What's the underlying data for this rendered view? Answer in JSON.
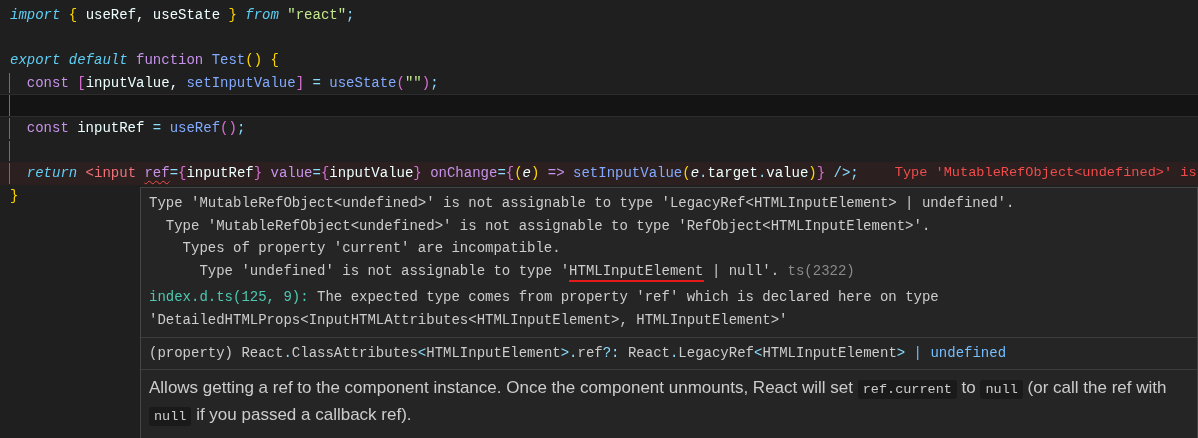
{
  "editor": {
    "lines": [
      {
        "current": false,
        "error": false,
        "indent_guide": false,
        "tokens": [
          {
            "text": "import",
            "kind": "keyword",
            "squiggle": false
          },
          {
            "text": " {",
            "kind": "brace",
            "squiggle": false
          },
          {
            "text": " useRef, useState ",
            "kind": "variable",
            "squiggle": false
          },
          {
            "text": "}",
            "kind": "brace",
            "squiggle": false
          },
          {
            "text": " from",
            "kind": "keyword",
            "squiggle": false
          },
          {
            "text": " \"react\"",
            "kind": "string",
            "squiggle": false
          },
          {
            "text": ";",
            "kind": "punct",
            "squiggle": false
          }
        ]
      },
      {
        "current": false,
        "error": false,
        "indent_guide": false
      },
      {
        "current": false,
        "error": false,
        "indent_guide": false,
        "tokens": [
          {
            "text": "export default",
            "kind": "keyword",
            "squiggle": false
          },
          {
            "text": " function",
            "kind": "storage",
            "squiggle": false
          },
          {
            "text": " Test",
            "kind": "function",
            "squiggle": false
          },
          {
            "text": "()",
            "kind": "brace",
            "squiggle": false
          },
          {
            "text": " {",
            "kind": "brace",
            "squiggle": false
          }
        ]
      },
      {
        "current": false,
        "error": false,
        "indent_guide": true,
        "tokens": [
          {
            "text": "  const",
            "kind": "storage",
            "squiggle": false
          },
          {
            "text": " [",
            "kind": "bracket",
            "squiggle": false
          },
          {
            "text": "inputValue, ",
            "kind": "variable",
            "squiggle": false
          },
          {
            "text": "setInputValue",
            "kind": "function",
            "squiggle": false
          },
          {
            "text": "]",
            "kind": "bracket",
            "squiggle": false
          },
          {
            "text": " =",
            "kind": "operator",
            "squiggle": false
          },
          {
            "text": " useState",
            "kind": "function",
            "squiggle": false
          },
          {
            "text": "(",
            "kind": "bracket",
            "squiggle": false
          },
          {
            "text": "\"\"",
            "kind": "string",
            "squiggle": false
          },
          {
            "text": ")",
            "kind": "bracket",
            "squiggle": false
          },
          {
            "text": ";",
            "kind": "punct",
            "squiggle": false
          }
        ]
      },
      {
        "current": true,
        "error": false,
        "indent_guide": true
      },
      {
        "current": false,
        "error": false,
        "indent_guide": true,
        "tokens": [
          {
            "text": "  const",
            "kind": "storage",
            "squiggle": false
          },
          {
            "text": " inputRef",
            "kind": "variable",
            "squiggle": false
          },
          {
            "text": " =",
            "kind": "operator",
            "squiggle": false
          },
          {
            "text": " useRef",
            "kind": "function",
            "squiggle": false
          },
          {
            "text": "()",
            "kind": "bracket",
            "squiggle": false
          },
          {
            "text": ";",
            "kind": "punct",
            "squiggle": false
          }
        ]
      },
      {
        "current": false,
        "error": false,
        "indent_guide": true
      },
      {
        "current": false,
        "error": true,
        "indent_guide": true,
        "diagnostic": "Type 'MutableRefObject<undefined>' is",
        "tokens": [
          {
            "text": "  return",
            "kind": "keyword",
            "squiggle": false
          },
          {
            "text": " <input ",
            "kind": "tag",
            "squiggle": false
          },
          {
            "text": "ref",
            "kind": "attribute",
            "squiggle": true
          },
          {
            "text": "=",
            "kind": "operator",
            "squiggle": false
          },
          {
            "text": "{",
            "kind": "bracket",
            "squiggle": false
          },
          {
            "text": "inputRef",
            "kind": "variable",
            "squiggle": false
          },
          {
            "text": "}",
            "kind": "bracket",
            "squiggle": false
          },
          {
            "text": " value",
            "kind": "attribute",
            "squiggle": false
          },
          {
            "text": "=",
            "kind": "operator",
            "squiggle": false
          },
          {
            "text": "{",
            "kind": "bracket",
            "squiggle": false
          },
          {
            "text": "inputValue",
            "kind": "variable",
            "squiggle": false
          },
          {
            "text": "}",
            "kind": "bracket",
            "squiggle": false
          },
          {
            "text": " onChange",
            "kind": "attribute",
            "squiggle": false
          },
          {
            "text": "=",
            "kind": "operator",
            "squiggle": false
          },
          {
            "text": "{",
            "kind": "bracket",
            "squiggle": false
          },
          {
            "text": "(",
            "kind": "brace",
            "squiggle": false
          },
          {
            "text": "e",
            "kind": "parameter",
            "squiggle": false
          },
          {
            "text": ")",
            "kind": "brace",
            "squiggle": false
          },
          {
            "text": " =>",
            "kind": "storage",
            "squiggle": false
          },
          {
            "text": " setInputValue",
            "kind": "function",
            "squiggle": false
          },
          {
            "text": "(",
            "kind": "brace",
            "squiggle": false
          },
          {
            "text": "e",
            "kind": "parameter",
            "squiggle": false
          },
          {
            "text": ".",
            "kind": "punct",
            "squiggle": false
          },
          {
            "text": "target",
            "kind": "variable",
            "squiggle": false
          },
          {
            "text": ".",
            "kind": "punct",
            "squiggle": false
          },
          {
            "text": "value",
            "kind": "variable",
            "squiggle": false
          },
          {
            "text": ")",
            "kind": "brace",
            "squiggle": false
          },
          {
            "text": "}",
            "kind": "bracket",
            "squiggle": false
          },
          {
            "text": " />",
            "kind": "punct",
            "squiggle": false
          },
          {
            "text": ";",
            "kind": "punct",
            "squiggle": false
          }
        ]
      },
      {
        "current": false,
        "error": false,
        "indent_guide": false,
        "tokens": [
          {
            "text": "}",
            "kind": "brace",
            "squiggle": false
          }
        ]
      }
    ]
  },
  "hover": {
    "messages": [
      {
        "segments": [
          {
            "text": "Type 'MutableRefObject<undefined>' is not assignable to type 'LegacyRef<HTMLInputElement> | undefined'.",
            "kind": "text"
          }
        ],
        "children": [
          {
            "segments": [
              {
                "text": "Type 'MutableRefObject<undefined>' is not assignable to type 'RefObject<HTMLInputElement>'.",
                "kind": "text"
              }
            ],
            "children": [
              {
                "segments": [
                  {
                    "text": "Types of property 'current' are incompatible.",
                    "kind": "text"
                  }
                ],
                "children": [
                  {
                    "segments": [
                      {
                        "text": "Type 'undefined' is not assignable to type '",
                        "kind": "text"
                      },
                      {
                        "text": "HTMLInputElement",
                        "kind": "underlined"
                      },
                      {
                        "text": " | null'.",
                        "kind": "text"
                      },
                      {
                        "text": " ts(2322)",
                        "kind": "code"
                      }
                    ]
                  }
                ]
              }
            ]
          }
        ]
      }
    ],
    "related": {
      "location": "index.d.ts(125, 9):",
      "text": " The expected type comes from property 'ref' which is declared here on type 'DetailedHTMLProps<InputHTMLAttributes<HTMLInputElement>, HTMLInputElement>'"
    },
    "signature": [
      {
        "text": "(property) React",
        "kind": "plain"
      },
      {
        "text": ".",
        "kind": "punct"
      },
      {
        "text": "ClassAttributes",
        "kind": "plain"
      },
      {
        "text": "<",
        "kind": "punct"
      },
      {
        "text": "HTMLInputElement",
        "kind": "plain"
      },
      {
        "text": ">.",
        "kind": "punct"
      },
      {
        "text": "ref",
        "kind": "plain"
      },
      {
        "text": "?:",
        "kind": "punct"
      },
      {
        "text": " React",
        "kind": "plain"
      },
      {
        "text": ".",
        "kind": "punct"
      },
      {
        "text": "LegacyRef",
        "kind": "plain"
      },
      {
        "text": "<",
        "kind": "punct"
      },
      {
        "text": "HTMLInputElement",
        "kind": "plain"
      },
      {
        "text": ">",
        "kind": "punct"
      },
      {
        "text": " | undefined",
        "kind": "keyword"
      }
    ],
    "doc": [
      {
        "text": "Allows getting a ref to the component instance. Once the component unmounts, React will set ",
        "kind": "text"
      },
      {
        "text": "ref.current",
        "kind": "code"
      },
      {
        "text": " to ",
        "kind": "text"
      },
      {
        "text": "null",
        "kind": "code"
      },
      {
        "text": " (or call the ref with ",
        "kind": "text"
      },
      {
        "text": "null",
        "kind": "code"
      },
      {
        "text": " if you passed a callback ref).",
        "kind": "text"
      }
    ]
  }
}
